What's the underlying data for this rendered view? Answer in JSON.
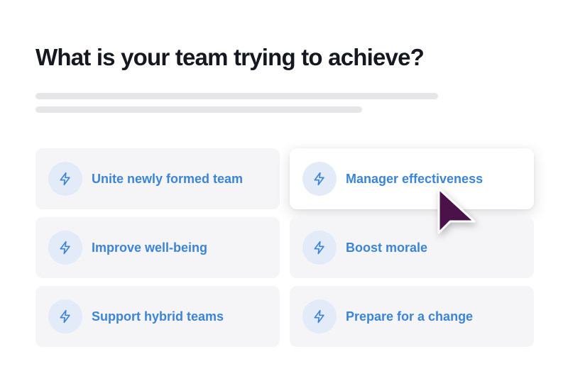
{
  "heading": "What is your team trying to achieve?",
  "icon": "lightning-bolt-icon",
  "accent_color": "#3b84d6",
  "cursor_color": "#4a1248",
  "options": [
    {
      "label": "Unite newly formed team",
      "selected": false
    },
    {
      "label": "Manager effectiveness",
      "selected": true
    },
    {
      "label": "Improve well-being",
      "selected": false
    },
    {
      "label": "Boost morale",
      "selected": false
    },
    {
      "label": "Support hybrid teams",
      "selected": false
    },
    {
      "label": "Prepare for a change",
      "selected": false
    }
  ]
}
